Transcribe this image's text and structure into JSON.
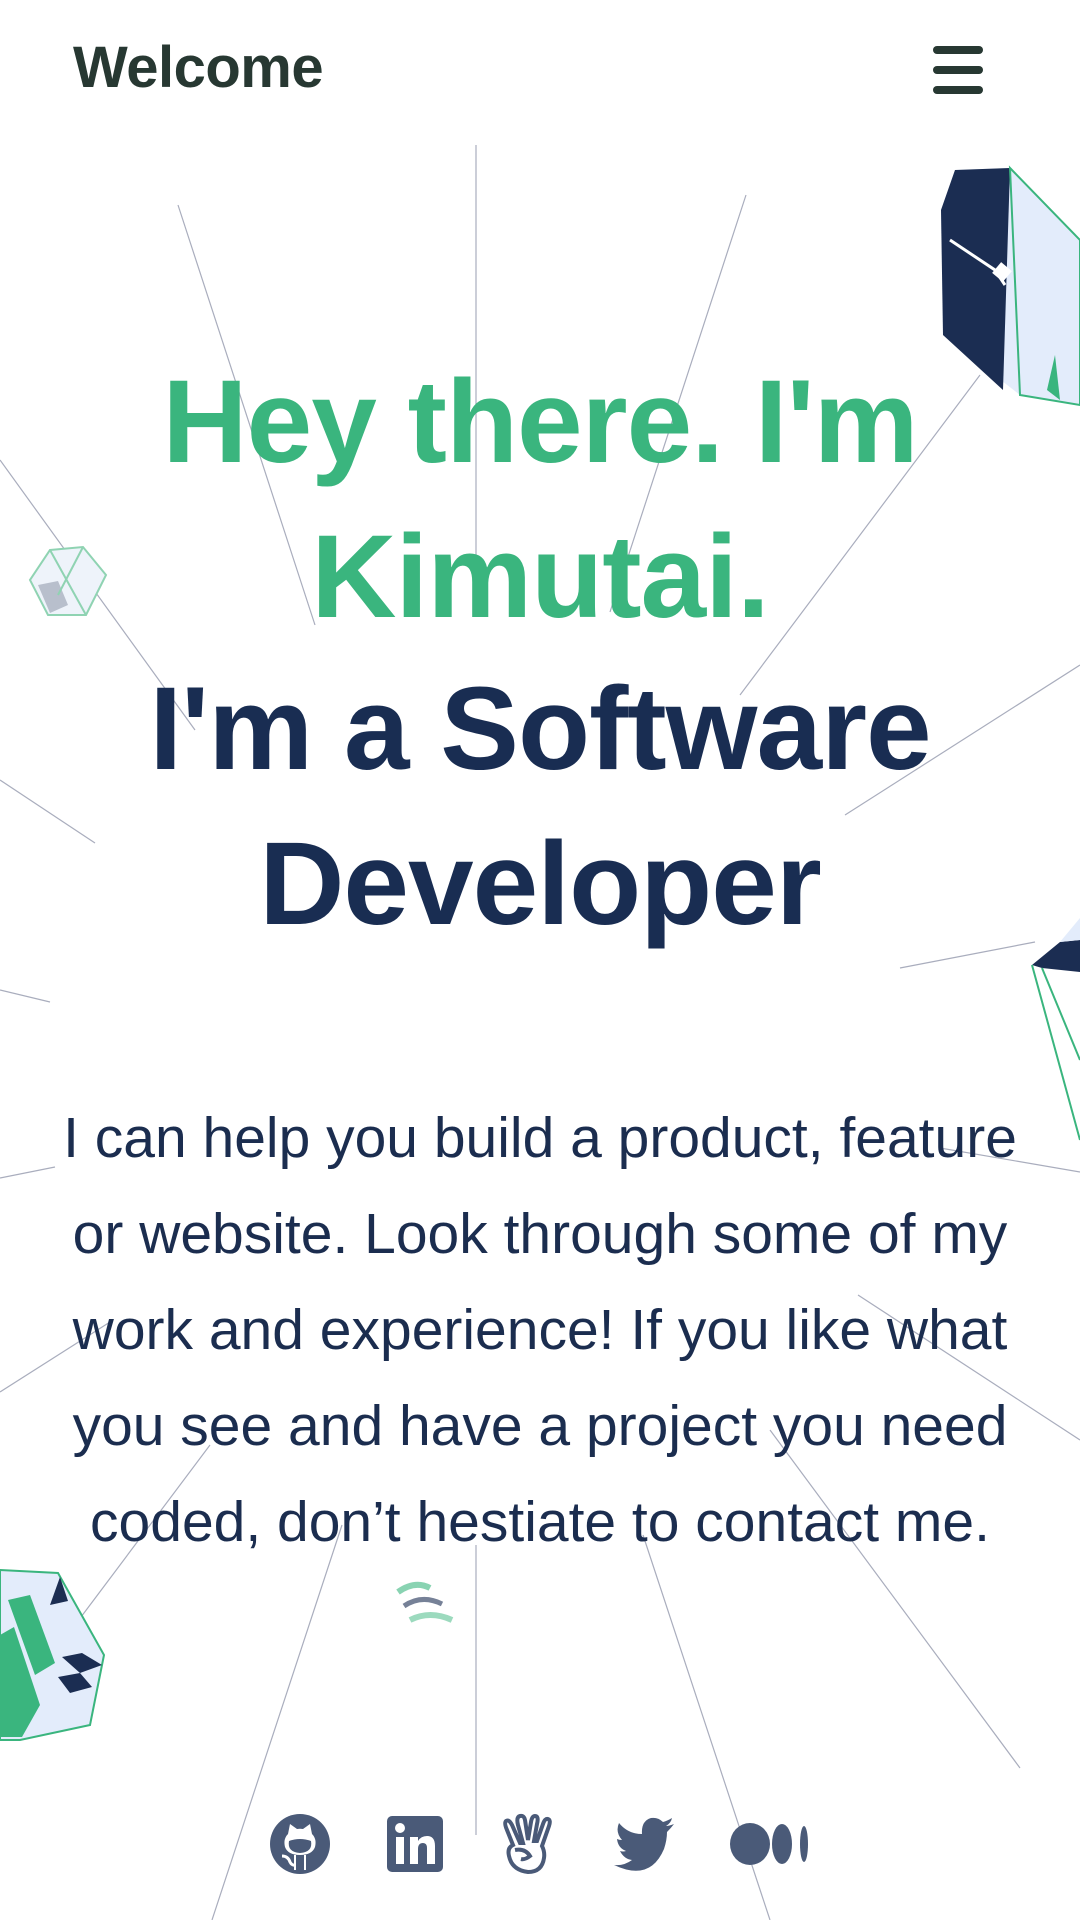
{
  "header": {
    "title": "Welcome",
    "menu_icon": "hamburger-menu-icon"
  },
  "hero": {
    "greeting_line1": "Hey there. I'm",
    "greeting_line2": "Kimutai.",
    "role_line1": "I'm a Software",
    "role_line2": "Developer"
  },
  "intro": {
    "text": "I can help you build a product, feature or website. Look through some of my work and experience! If you like what you see and have a project you need coded, don’t hestiate to contact me."
  },
  "socials": [
    {
      "icon": "github-icon"
    },
    {
      "icon": "linkedin-icon"
    },
    {
      "icon": "angellist-icon"
    },
    {
      "icon": "twitter-icon"
    },
    {
      "icon": "medium-icon"
    }
  ],
  "colors": {
    "accent_green": "#3ab57e",
    "navy": "#192d52",
    "header_text": "#273832",
    "icon_gray": "#4a5a78",
    "light_blue": "#e3ecfb"
  }
}
